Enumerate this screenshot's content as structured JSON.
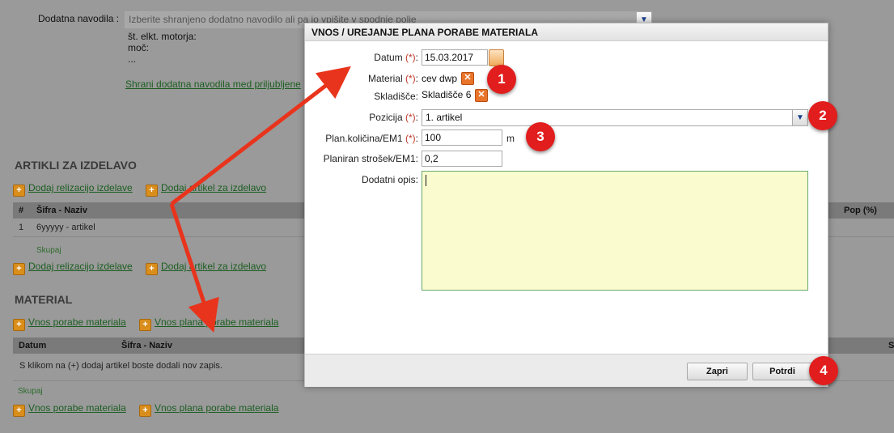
{
  "background": {
    "instructions_label": "Dodatna navodila",
    "instructions_select_placeholder": "Izberite shranjeno dodatno navodilo ali pa jo vpišite v spodnje polje",
    "instructions_text": [
      "št. elkt. motorja:",
      "moč:",
      "..."
    ],
    "save_instructions_link": "Shrani dodatna navodila med priljubljene",
    "articles_section_title": "ARTIKLI ZA IZDELAVO",
    "add_realization_link": "Dodaj relizacijo izdelave",
    "add_article_link": "Dodaj artikel za izdelavo",
    "articles_table": {
      "headers": [
        "#",
        "Šifra - Naziv",
        "Pop (%)"
      ],
      "rows": [
        [
          "1",
          "6yyyyy - artikel"
        ]
      ],
      "total_label": "Skupaj"
    },
    "material_section_title": "MATERIAL",
    "material_consumption_link": "Vnos porabe materiala",
    "material_plan_link": "Vnos plana porabe materiala",
    "material_table": {
      "headers": [
        "Datum",
        "Šifra - Naziv",
        "S"
      ],
      "empty_text": "S klikom na (+) dodaj artikel boste dodali nov zapis.",
      "total_label": "Skupaj"
    }
  },
  "modal": {
    "title": "VNOS / UREJANJE PLANA PORABE MATERIALA",
    "required_mark": "(*)",
    "date": {
      "label": "Datum",
      "value": "15.03.2017"
    },
    "material": {
      "label": "Material",
      "value": "cev dwp"
    },
    "warehouse": {
      "label": "Skladišče",
      "value": "Skladišče 6"
    },
    "position": {
      "label": "Pozicija",
      "value": "1. artikel"
    },
    "quantity": {
      "label": "Plan.količina/EM1",
      "value": "100",
      "unit": "m"
    },
    "cost": {
      "label": "Planiran strošek/EM1",
      "value": "0,2"
    },
    "description": {
      "label": "Dodatni opis",
      "value": ""
    },
    "close_label": "Zapri",
    "confirm_label": "Potrdi"
  },
  "badges": [
    "1",
    "2",
    "3",
    "4"
  ],
  "colors": {
    "accent_red": "#e21d1d",
    "link_green": "#1b5e20",
    "textarea_bg": "#fafcd0"
  }
}
